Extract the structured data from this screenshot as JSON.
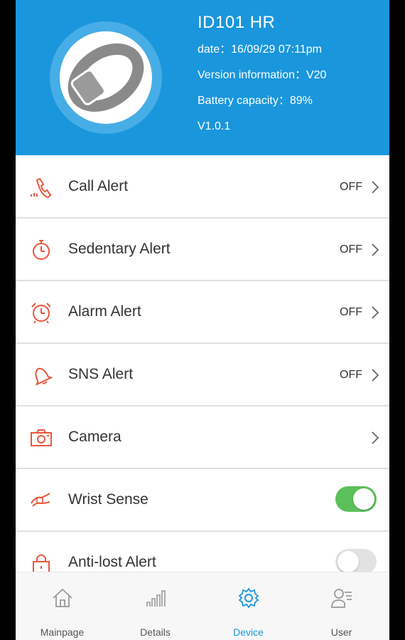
{
  "device": {
    "name": "ID101 HR",
    "date_line": "date：16/09/29 07:11pm",
    "version_line": "Version information：V20",
    "battery_line": "Battery capacity：89%",
    "firmware_line": "V1.0.1"
  },
  "settings": [
    {
      "label": "Call Alert",
      "status": "OFF",
      "icon": "phone-vibrate-icon"
    },
    {
      "label": "Sedentary Alert",
      "status": "OFF",
      "icon": "stopwatch-icon"
    },
    {
      "label": "Alarm Alert",
      "status": "OFF",
      "icon": "alarm-clock-icon"
    },
    {
      "label": "SNS Alert",
      "status": "OFF",
      "icon": "bell-icon"
    },
    {
      "label": "Camera",
      "status": "",
      "icon": "camera-icon"
    },
    {
      "label": "Wrist Sense",
      "toggle": true,
      "icon": "wrist-icon"
    },
    {
      "label": "Anti-lost Alert",
      "toggle": false,
      "icon": "lock-icon"
    }
  ],
  "tabs": [
    {
      "label": "Mainpage",
      "icon": "home-icon"
    },
    {
      "label": "Details",
      "icon": "bar-chart-icon"
    },
    {
      "label": "Device",
      "icon": "gear-icon",
      "active": true
    },
    {
      "label": "User",
      "icon": "user-list-icon"
    }
  ],
  "colors": {
    "header": "#1a96dc",
    "accent_icon": "#e9563b",
    "toggle_on": "#5cc05a",
    "active_tab": "#1a96dc"
  }
}
